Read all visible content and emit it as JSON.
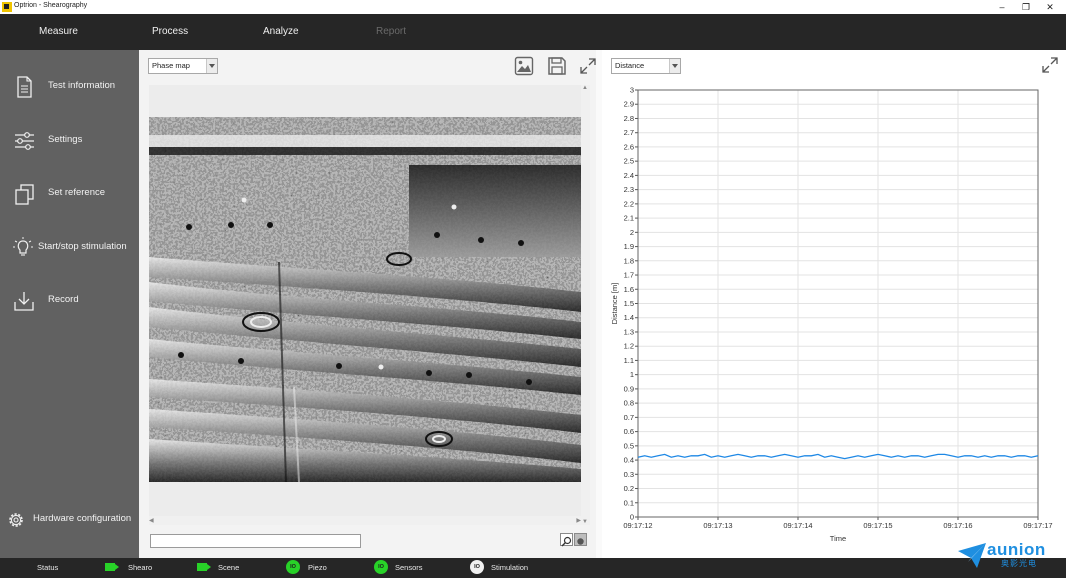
{
  "window": {
    "title": "Optrion - Shearography",
    "minimize": "–",
    "restore": "❐",
    "close": "✕"
  },
  "nav": {
    "tabs": [
      {
        "label": "Measure",
        "enabled": true
      },
      {
        "label": "Process",
        "enabled": true
      },
      {
        "label": "Analyze",
        "enabled": true
      },
      {
        "label": "Report",
        "enabled": false
      }
    ]
  },
  "sidebar": {
    "items": [
      {
        "label": "Test information",
        "icon": "document-icon"
      },
      {
        "label": "Settings",
        "icon": "sliders-icon"
      },
      {
        "label": "Set reference",
        "icon": "copy-icon"
      },
      {
        "label": "Start/stop stimulation",
        "icon": "lightbulb-icon"
      },
      {
        "label": "Record",
        "icon": "download-icon"
      }
    ],
    "footer": {
      "label": "Hardware configuration",
      "icon": "gear-icon"
    }
  },
  "left_panel": {
    "view_select": "Phase map",
    "path_value": ""
  },
  "right_panel": {
    "measure_select": "Distance"
  },
  "chart_data": {
    "type": "line",
    "title": "",
    "xlabel": "Time",
    "ylabel": "Distance [m]",
    "ylim": [
      0,
      3
    ],
    "yticks": [
      "0",
      "0.1",
      "0.2",
      "0.3",
      "0.4",
      "0.5",
      "0.6",
      "0.7",
      "0.8",
      "0.9",
      "1",
      "1.1",
      "1.2",
      "1.3",
      "1.4",
      "1.5",
      "1.6",
      "1.7",
      "1.8",
      "1.9",
      "2",
      "2.1",
      "2.2",
      "2.3",
      "2.4",
      "2.5",
      "2.6",
      "2.7",
      "2.8",
      "2.9",
      "3"
    ],
    "xticks": [
      "09:17:12",
      "09:17:13",
      "09:17:14",
      "09:17:15",
      "09:17:16",
      "09:17:17"
    ],
    "grid": true,
    "color": "#1e88e5",
    "series": [
      {
        "values": [
          0.42,
          0.43,
          0.42,
          0.43,
          0.44,
          0.42,
          0.43,
          0.42,
          0.43,
          0.43,
          0.44,
          0.42,
          0.43,
          0.42,
          0.43,
          0.44,
          0.43,
          0.42,
          0.43,
          0.43,
          0.42,
          0.43,
          0.44,
          0.43,
          0.42,
          0.43,
          0.43,
          0.44,
          0.42,
          0.43,
          0.42,
          0.41,
          0.42,
          0.43,
          0.42,
          0.43,
          0.44,
          0.43,
          0.42,
          0.43,
          0.42,
          0.43,
          0.43,
          0.42,
          0.43,
          0.44,
          0.44,
          0.43,
          0.42,
          0.43,
          0.43,
          0.42,
          0.43,
          0.42,
          0.43,
          0.43,
          0.42,
          0.43,
          0.43,
          0.42,
          0.43
        ]
      }
    ]
  },
  "status": {
    "status_label": "Status",
    "shearo": "Shearo",
    "scene": "Scene",
    "piezo": "Piezo",
    "sensors": "Sensors",
    "stimulation": "Stimulation",
    "io": "IO"
  },
  "brand": {
    "name": "aunion",
    "sub": "奥影光电"
  }
}
